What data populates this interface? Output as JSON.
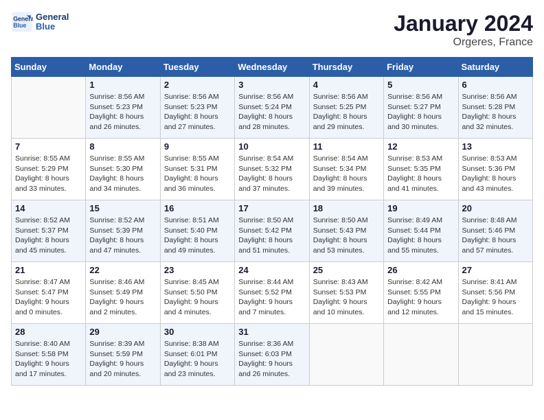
{
  "header": {
    "logo_line1": "General",
    "logo_line2": "Blue",
    "month": "January 2024",
    "location": "Orgeres, France"
  },
  "days_of_week": [
    "Sunday",
    "Monday",
    "Tuesday",
    "Wednesday",
    "Thursday",
    "Friday",
    "Saturday"
  ],
  "weeks": [
    [
      {
        "day": "",
        "info": ""
      },
      {
        "day": "1",
        "info": "Sunrise: 8:56 AM\nSunset: 5:23 PM\nDaylight: 8 hours\nand 26 minutes."
      },
      {
        "day": "2",
        "info": "Sunrise: 8:56 AM\nSunset: 5:23 PM\nDaylight: 8 hours\nand 27 minutes."
      },
      {
        "day": "3",
        "info": "Sunrise: 8:56 AM\nSunset: 5:24 PM\nDaylight: 8 hours\nand 28 minutes."
      },
      {
        "day": "4",
        "info": "Sunrise: 8:56 AM\nSunset: 5:25 PM\nDaylight: 8 hours\nand 29 minutes."
      },
      {
        "day": "5",
        "info": "Sunrise: 8:56 AM\nSunset: 5:27 PM\nDaylight: 8 hours\nand 30 minutes."
      },
      {
        "day": "6",
        "info": "Sunrise: 8:56 AM\nSunset: 5:28 PM\nDaylight: 8 hours\nand 32 minutes."
      }
    ],
    [
      {
        "day": "7",
        "info": "Sunrise: 8:55 AM\nSunset: 5:29 PM\nDaylight: 8 hours\nand 33 minutes."
      },
      {
        "day": "8",
        "info": "Sunrise: 8:55 AM\nSunset: 5:30 PM\nDaylight: 8 hours\nand 34 minutes."
      },
      {
        "day": "9",
        "info": "Sunrise: 8:55 AM\nSunset: 5:31 PM\nDaylight: 8 hours\nand 36 minutes."
      },
      {
        "day": "10",
        "info": "Sunrise: 8:54 AM\nSunset: 5:32 PM\nDaylight: 8 hours\nand 37 minutes."
      },
      {
        "day": "11",
        "info": "Sunrise: 8:54 AM\nSunset: 5:34 PM\nDaylight: 8 hours\nand 39 minutes."
      },
      {
        "day": "12",
        "info": "Sunrise: 8:53 AM\nSunset: 5:35 PM\nDaylight: 8 hours\nand 41 minutes."
      },
      {
        "day": "13",
        "info": "Sunrise: 8:53 AM\nSunset: 5:36 PM\nDaylight: 8 hours\nand 43 minutes."
      }
    ],
    [
      {
        "day": "14",
        "info": "Sunrise: 8:52 AM\nSunset: 5:37 PM\nDaylight: 8 hours\nand 45 minutes."
      },
      {
        "day": "15",
        "info": "Sunrise: 8:52 AM\nSunset: 5:39 PM\nDaylight: 8 hours\nand 47 minutes."
      },
      {
        "day": "16",
        "info": "Sunrise: 8:51 AM\nSunset: 5:40 PM\nDaylight: 8 hours\nand 49 minutes."
      },
      {
        "day": "17",
        "info": "Sunrise: 8:50 AM\nSunset: 5:42 PM\nDaylight: 8 hours\nand 51 minutes."
      },
      {
        "day": "18",
        "info": "Sunrise: 8:50 AM\nSunset: 5:43 PM\nDaylight: 8 hours\nand 53 minutes."
      },
      {
        "day": "19",
        "info": "Sunrise: 8:49 AM\nSunset: 5:44 PM\nDaylight: 8 hours\nand 55 minutes."
      },
      {
        "day": "20",
        "info": "Sunrise: 8:48 AM\nSunset: 5:46 PM\nDaylight: 8 hours\nand 57 minutes."
      }
    ],
    [
      {
        "day": "21",
        "info": "Sunrise: 8:47 AM\nSunset: 5:47 PM\nDaylight: 9 hours\nand 0 minutes."
      },
      {
        "day": "22",
        "info": "Sunrise: 8:46 AM\nSunset: 5:49 PM\nDaylight: 9 hours\nand 2 minutes."
      },
      {
        "day": "23",
        "info": "Sunrise: 8:45 AM\nSunset: 5:50 PM\nDaylight: 9 hours\nand 4 minutes."
      },
      {
        "day": "24",
        "info": "Sunrise: 8:44 AM\nSunset: 5:52 PM\nDaylight: 9 hours\nand 7 minutes."
      },
      {
        "day": "25",
        "info": "Sunrise: 8:43 AM\nSunset: 5:53 PM\nDaylight: 9 hours\nand 10 minutes."
      },
      {
        "day": "26",
        "info": "Sunrise: 8:42 AM\nSunset: 5:55 PM\nDaylight: 9 hours\nand 12 minutes."
      },
      {
        "day": "27",
        "info": "Sunrise: 8:41 AM\nSunset: 5:56 PM\nDaylight: 9 hours\nand 15 minutes."
      }
    ],
    [
      {
        "day": "28",
        "info": "Sunrise: 8:40 AM\nSunset: 5:58 PM\nDaylight: 9 hours\nand 17 minutes."
      },
      {
        "day": "29",
        "info": "Sunrise: 8:39 AM\nSunset: 5:59 PM\nDaylight: 9 hours\nand 20 minutes."
      },
      {
        "day": "30",
        "info": "Sunrise: 8:38 AM\nSunset: 6:01 PM\nDaylight: 9 hours\nand 23 minutes."
      },
      {
        "day": "31",
        "info": "Sunrise: 8:36 AM\nSunset: 6:03 PM\nDaylight: 9 hours\nand 26 minutes."
      },
      {
        "day": "",
        "info": ""
      },
      {
        "day": "",
        "info": ""
      },
      {
        "day": "",
        "info": ""
      }
    ]
  ]
}
